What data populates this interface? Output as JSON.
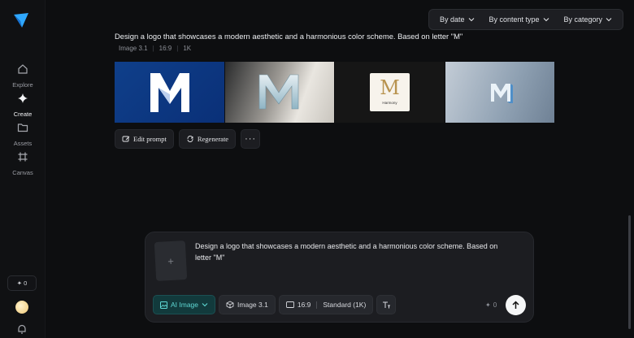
{
  "sidebar": {
    "items": [
      {
        "label": "Explore",
        "icon": "home-icon"
      },
      {
        "label": "Create",
        "icon": "sparkle-icon"
      },
      {
        "label": "Assets",
        "icon": "folder-icon"
      },
      {
        "label": "Canvas",
        "icon": "canvas-grid-icon"
      }
    ],
    "credits": "0"
  },
  "filters": {
    "date": "By date",
    "content_type": "By content type",
    "category": "By category"
  },
  "result": {
    "prompt": "Design a logo that showcases a modern aesthetic and a harmonious color scheme. Based on letter \"M\"",
    "model": "Image 3.1",
    "ratio": "16:9",
    "resolution": "1K",
    "images": [
      {
        "letter": "M"
      },
      {
        "letter": "M"
      },
      {
        "letter": "M",
        "caption": "Harmony"
      },
      {
        "letter": "M"
      }
    ],
    "actions": {
      "edit": "Edit prompt",
      "regenerate": "Regenerate",
      "more": "···"
    }
  },
  "composer": {
    "text": "Design a logo that showcases a modern aesthetic and a harmonious color scheme. Based on letter \"M\"",
    "ai_mode": "AI Image",
    "model": "Image 3.1",
    "ratio": "16:9",
    "quality": "Standard (1K)",
    "cost": "0"
  },
  "colors": {
    "accent": "#5fd8d4",
    "background": "#0d0e10"
  }
}
